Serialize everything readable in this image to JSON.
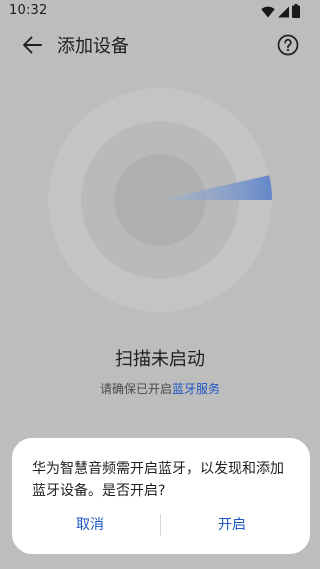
{
  "status_bar": {
    "time": "10:32",
    "icons": [
      "wifi-icon",
      "signal-icon",
      "battery-icon"
    ]
  },
  "app_bar": {
    "back_icon": "arrow-left-icon",
    "title": "添加设备",
    "help_icon": "help-circle-icon"
  },
  "scan": {
    "title": "扫描未启动",
    "hint_prefix": "请确保已开启",
    "hint_link": "蓝牙服务"
  },
  "dialog": {
    "message": "华为智慧音频需开启蓝牙，以发现和添加蓝牙设备。是否开启?",
    "cancel_label": "取消",
    "confirm_label": "开启"
  },
  "colors": {
    "background": "#bdbdbd",
    "accent": "#1a56c4",
    "dialog_bg": "#ffffff"
  }
}
